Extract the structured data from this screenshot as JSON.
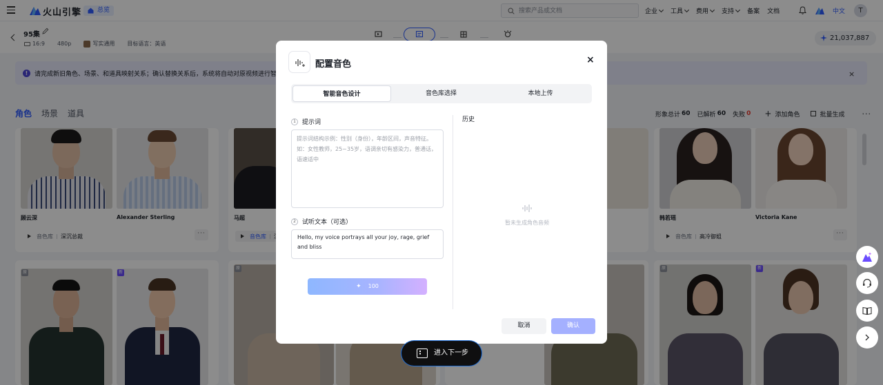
{
  "topbar": {
    "logo_text": "火山引擎",
    "overview": "总览",
    "search_placeholder": "搜索产品或文档",
    "nav": [
      "企业",
      "工具",
      "费用",
      "支持",
      "备案",
      "文档"
    ],
    "lang": "中文",
    "avatar": "T"
  },
  "project": {
    "title": "95集",
    "ratio": "16:9",
    "resolution": "480p",
    "style": "写实通用",
    "target_lang": "目标语言：英语",
    "credits": "21,037,887"
  },
  "notice": {
    "text": "请完成新旧角色、场景、和道具映射关系；确认替换关系后，系统将自动对原视频进行智能处"
  },
  "tabs": [
    "角色",
    "场景",
    "道具"
  ],
  "toolbar": {
    "total_label": "形象总计",
    "total": "60",
    "parsed_label": "已解析",
    "parsed": "60",
    "failed_label": "失败",
    "failed": "0",
    "add_role": "添加角色",
    "batch": "批量生成"
  },
  "cards": {
    "c1": {
      "name_a": "顾云深",
      "name_b": "Alexander Sterling",
      "lib": "音色库",
      "voice": "深沉总裁"
    },
    "c2": {
      "name_a": "马超",
      "lib": "音色库",
      "voice": "沉"
    },
    "c3": {
      "name_a": "韩若瑶",
      "name_b": "Victoria Kane",
      "lib": "音色库",
      "voice": "高冷御姐"
    },
    "badges": {
      "old": "原",
      "new": "新"
    }
  },
  "modal": {
    "title": "配置音色",
    "close": "×",
    "tabs": [
      "智能音色设计",
      "音色库选择",
      "本地上传"
    ],
    "prompt_label": "提示词",
    "prompt_placeholder": "提示词结构示例：性别（身份），年龄区间，声音特征。如：女性教师，25~35岁，语调亲切有感染力，普通话，语速适中",
    "sample_label": "试听文本（可选）",
    "sample_text": "Hello, my voice portrays all your joy, rage, grief and bliss",
    "generate_cost": "100",
    "history_label": "历史",
    "empty_text": "暂未生成角色音频",
    "cancel": "取消",
    "confirm": "确认",
    "step_numbers": [
      "1",
      "2"
    ]
  },
  "next_step": "进入下一步",
  "colors": {
    "primary": "#2f5cff",
    "confirm_disabled": "#a4b0ff",
    "failed": "#e5392e"
  }
}
